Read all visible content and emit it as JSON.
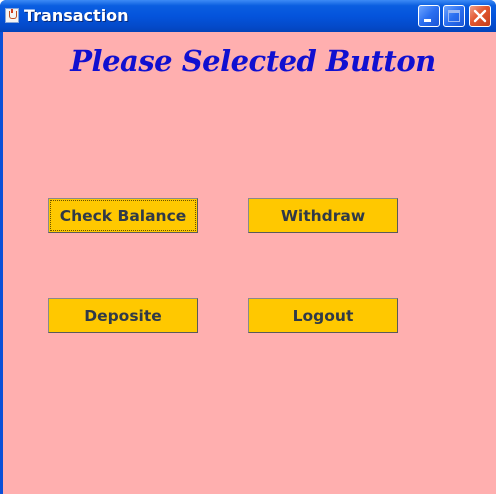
{
  "window": {
    "title": "Transaction",
    "app_icon": "java-cup-icon",
    "controls": {
      "minimize_icon": "minimize-icon",
      "maximize_icon": "maximize-icon",
      "close_icon": "close-icon"
    }
  },
  "main": {
    "heading": "Please Selected Button",
    "buttons": {
      "check_balance": "Check Balance",
      "withdraw": "Withdraw",
      "deposite": "Deposite",
      "logout": "Logout"
    },
    "focused_button": "check_balance"
  },
  "colors": {
    "titlebar_blue": "#0454dc",
    "content_background": "#ffafaf",
    "heading_text": "#1010d0",
    "button_background": "#ffc800",
    "button_text": "#303a48",
    "close_button": "#e2562e"
  }
}
